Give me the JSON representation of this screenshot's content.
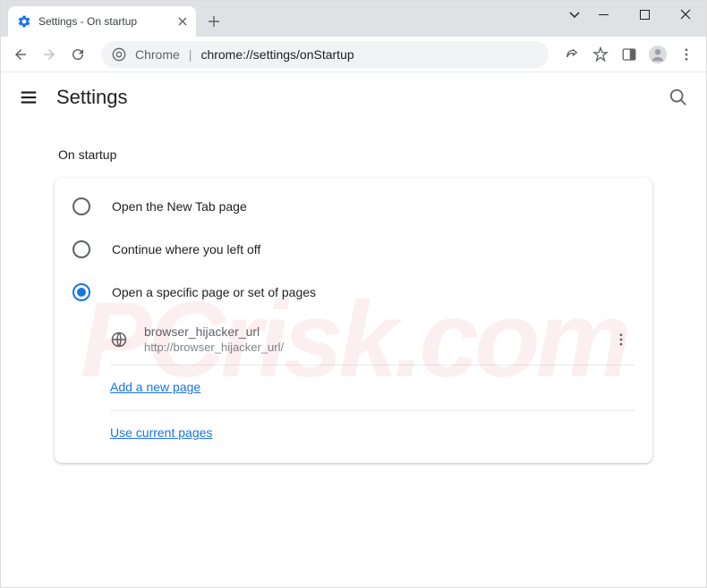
{
  "window": {
    "title": "Settings - On startup"
  },
  "omnibox": {
    "label": "Chrome",
    "url": "chrome://settings/onStartup"
  },
  "header": {
    "title": "Settings"
  },
  "section": {
    "title": "On startup"
  },
  "radios": {
    "r0": "Open the New Tab page",
    "r1": "Continue where you left off",
    "r2": "Open a specific page or set of pages"
  },
  "page": {
    "name": "browser_hijacker_url",
    "url": "http://browser_hijacker_url/"
  },
  "links": {
    "add": "Add a new page",
    "use": "Use current pages"
  },
  "watermark": "PCrisk.com"
}
